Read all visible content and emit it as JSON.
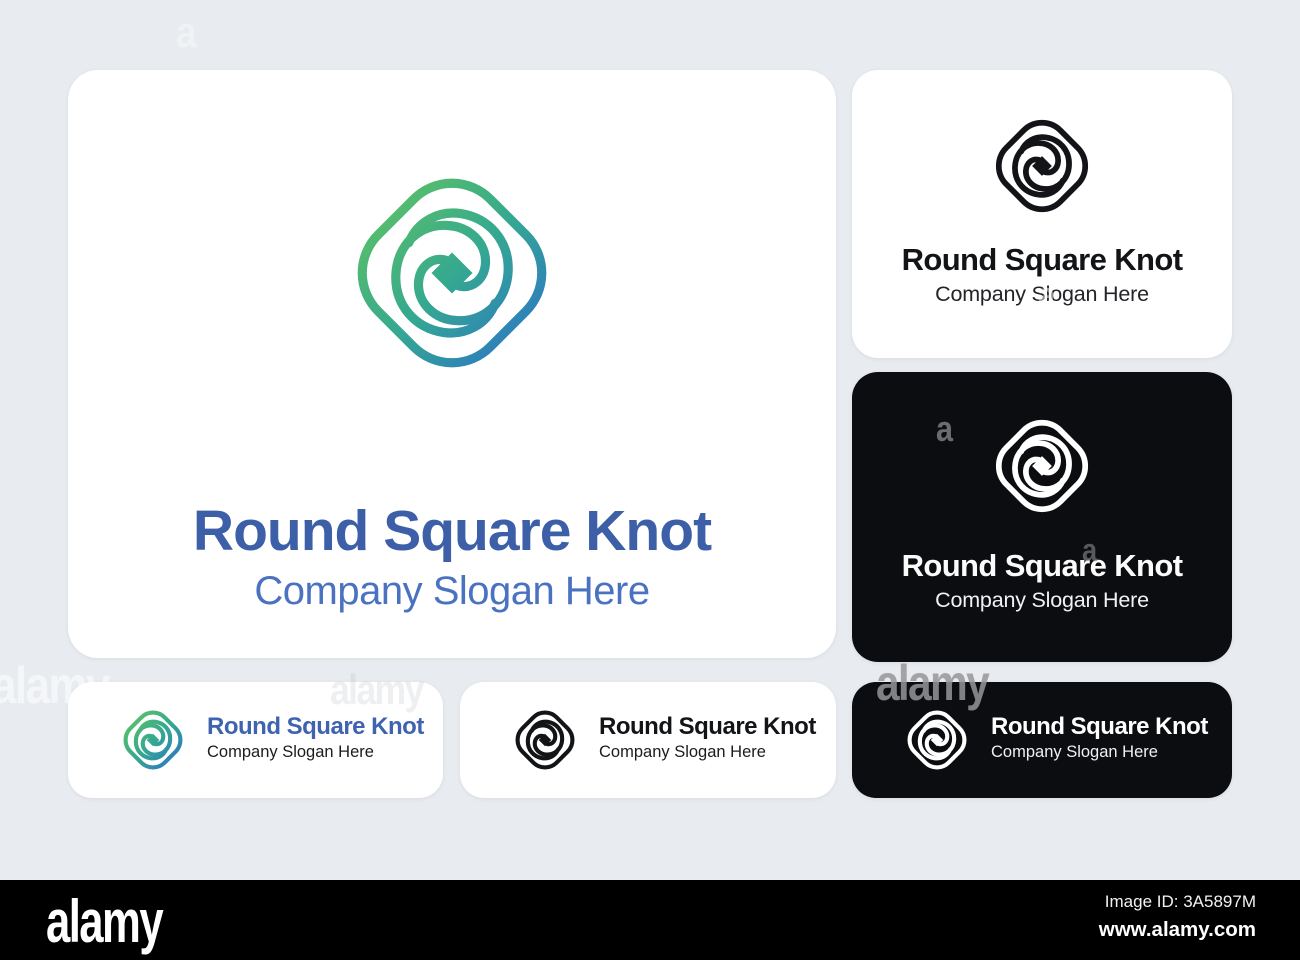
{
  "watermark": {
    "text": "alamy",
    "letter": "a"
  },
  "logo": {
    "name": "round-square-knot-mark",
    "gradient_start": "#5CC066",
    "gradient_mid": "#35A98F",
    "gradient_end": "#2C77C5",
    "dark": "#131417",
    "light": "#FFFFFF",
    "title_blue": "#3D5FA8",
    "slogan_blue": "#4A72C1"
  },
  "cards": {
    "main": {
      "title": "Round Square Knot",
      "slogan": "Company Slogan Here"
    },
    "top_right": {
      "title": "Round Square Knot",
      "slogan": "Company Slogan Here"
    },
    "middle_right": {
      "title": "Round Square Knot",
      "slogan": "Company Slogan Here"
    },
    "bottom_left": {
      "title": "Round Square Knot",
      "slogan": "Company Slogan Here"
    },
    "bottom_center": {
      "title": "Round Square Knot",
      "slogan": "Company Slogan Here"
    },
    "bottom_right": {
      "title": "Round Square Knot",
      "slogan": "Company Slogan Here"
    }
  },
  "footer": {
    "brand": "alamy",
    "image_id": "Image ID: 3A5897M",
    "website": "www.alamy.com"
  }
}
